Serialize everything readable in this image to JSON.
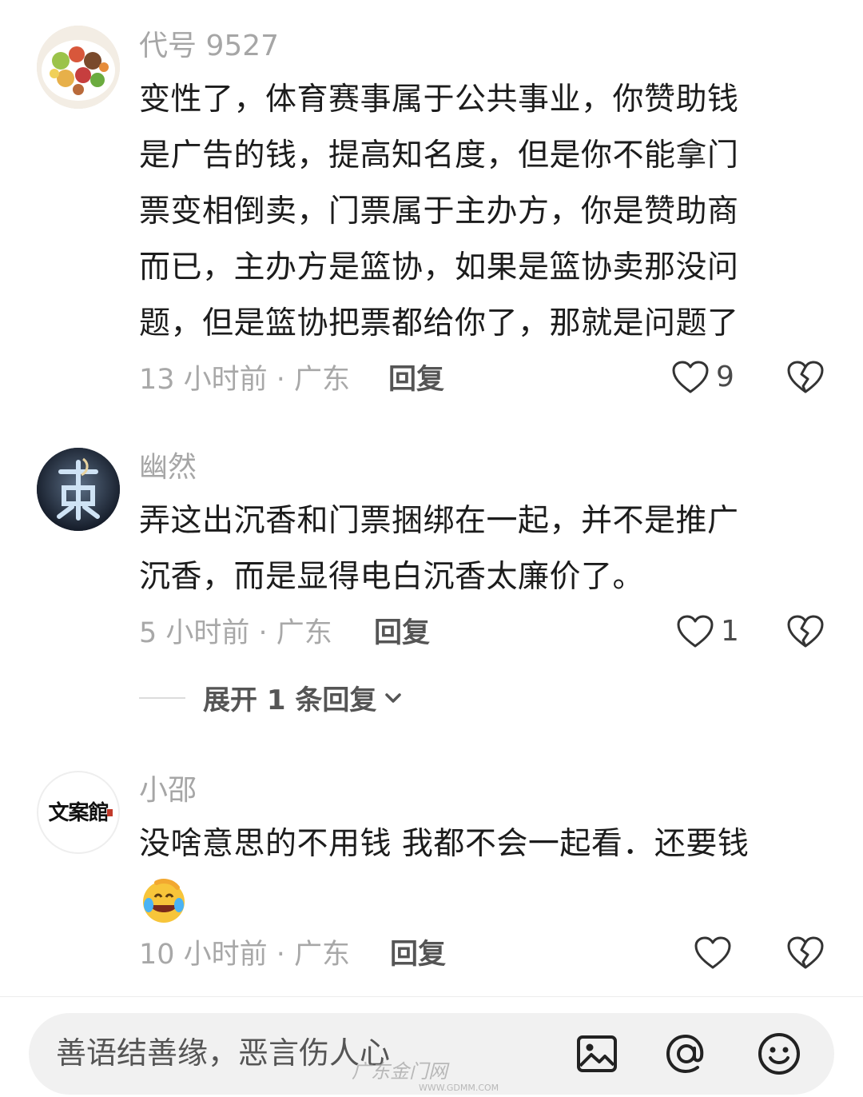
{
  "comments": [
    {
      "username": "代号 9527",
      "lines": [
        "变性了，体育赛事属于公共事业，你赞助钱",
        "是广告的钱，提高知名度，但是你不能拿门",
        "票变相倒卖，门票属于主办方，你是赞助商",
        "而已，主办方是篮协，如果是篮协卖那没问",
        "题，但是篮协把票都给你了，那就是问题了"
      ],
      "meta": "13 小时前 · 广东",
      "reply_label": "回复",
      "like_count": "9"
    },
    {
      "username": "幽然",
      "lines": [
        "弄这出沉香和门票捆绑在一起，并不是推广",
        "沉香，而是显得电白沉香太廉价了。"
      ],
      "meta": "5 小时前 · 广东",
      "reply_label": "回复",
      "like_count": "1",
      "expand_label": "展开 1 条回复"
    },
    {
      "username": "小邵",
      "lines": [
        "没啥意思的不用钱 我都不会一起看．还要钱"
      ],
      "emoji": "😂",
      "meta": "10 小时前 · 广东",
      "reply_label": "回复",
      "like_count": ""
    }
  ],
  "input": {
    "placeholder": "善语结善缘，恶言伤人心"
  },
  "icons": {
    "like": "heart-outline-icon",
    "dislike": "broken-heart-icon",
    "image": "image-icon",
    "mention": "at-icon",
    "emoji": "smiley-icon",
    "expand": "chevron-down-icon"
  },
  "avatars": {
    "third_avatar_text": "文案館"
  },
  "watermark": {
    "text": "广东金门网",
    "url": "WWW.GDMM.COM"
  }
}
